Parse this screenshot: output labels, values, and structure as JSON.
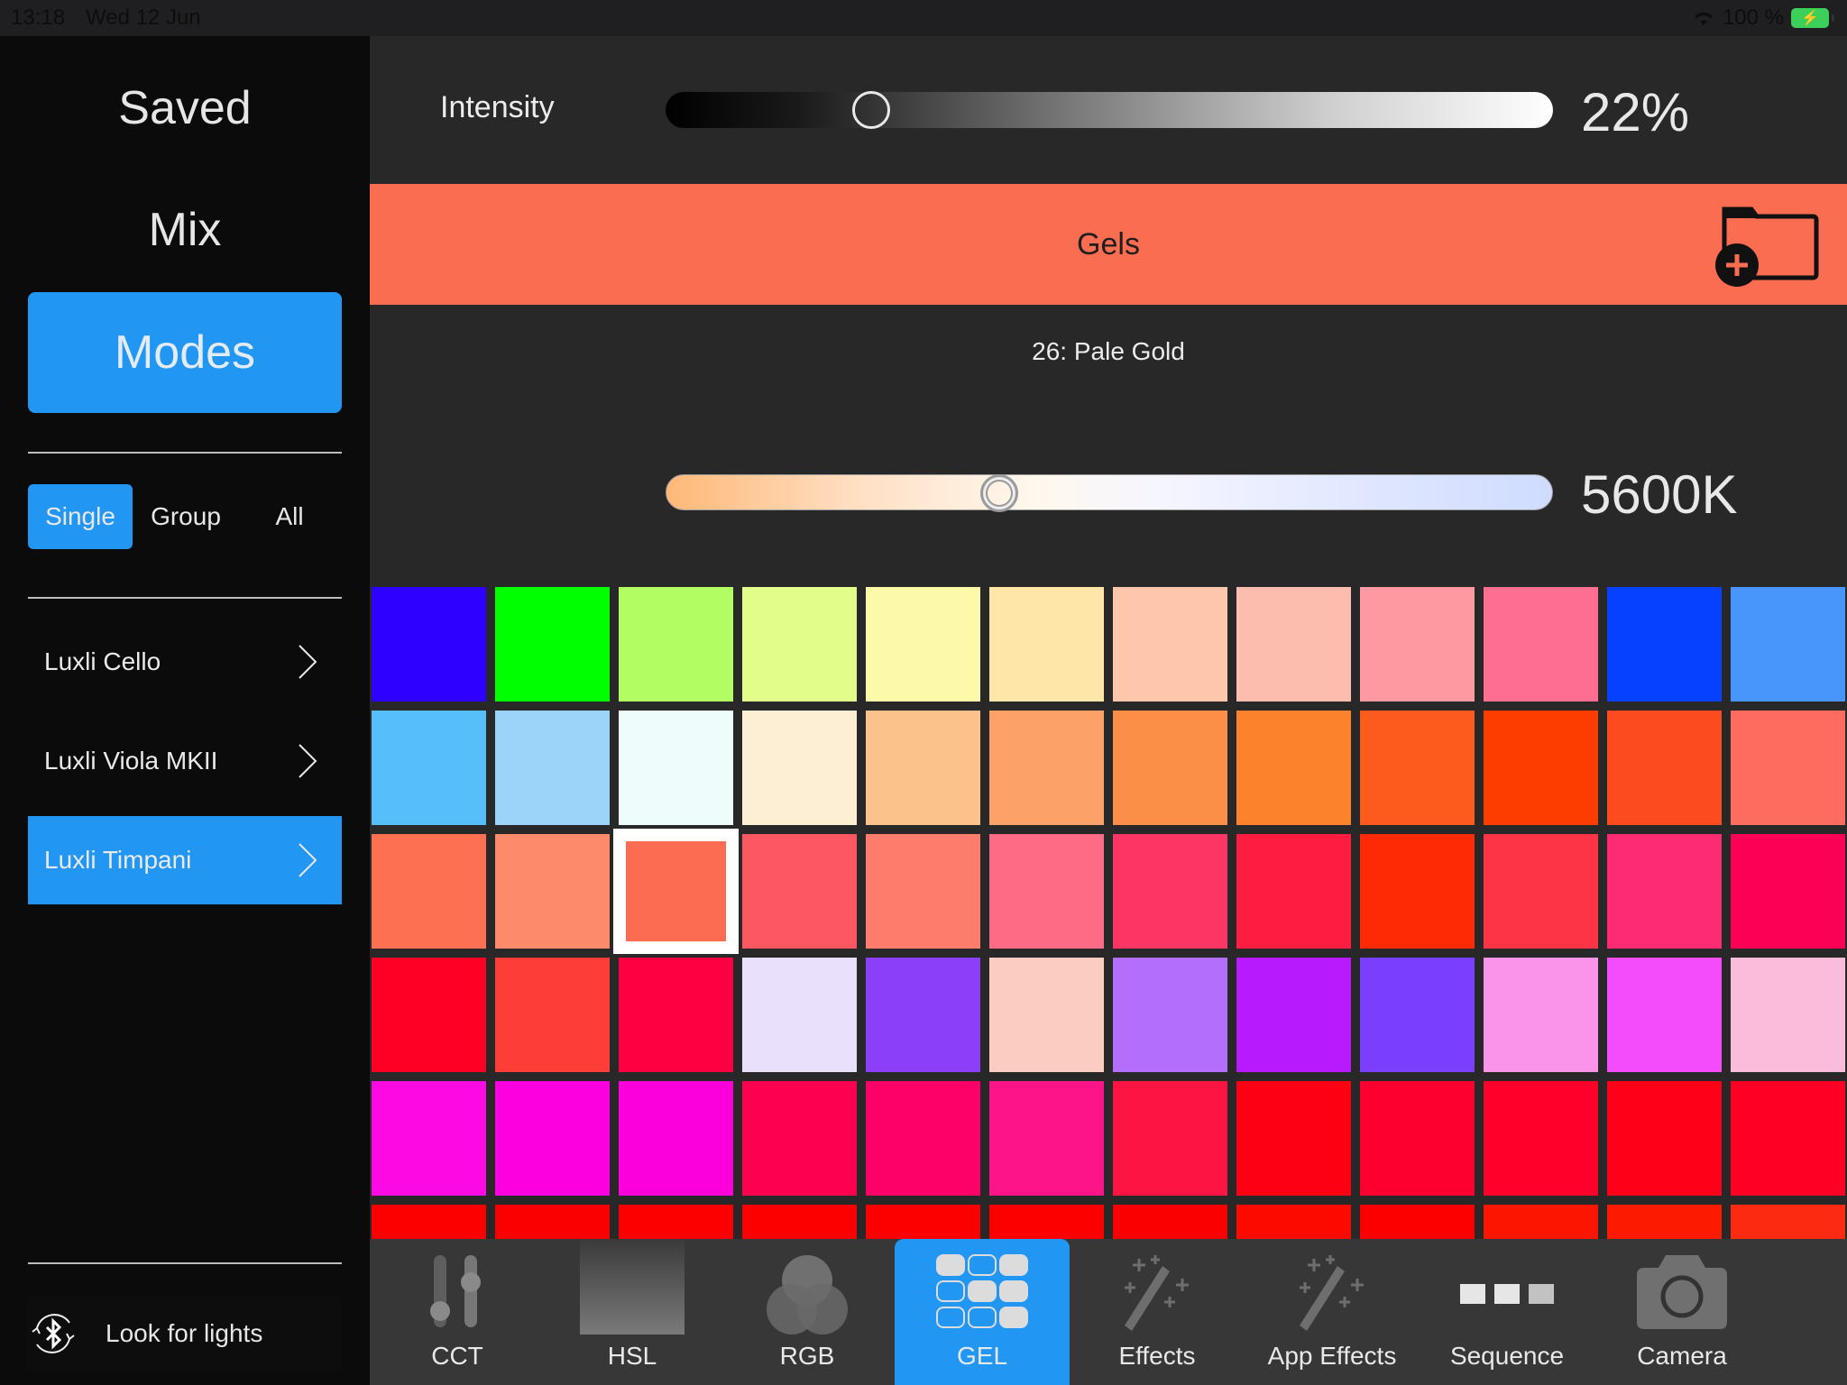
{
  "status_bar": {
    "time": "13:18",
    "date": "Wed 12 Jun",
    "battery": "100 %"
  },
  "sidebar": {
    "nav": [
      {
        "label": "Saved",
        "active": false
      },
      {
        "label": "Mix",
        "active": false
      },
      {
        "label": "Modes",
        "active": true
      }
    ],
    "scope": [
      {
        "label": "Single",
        "active": true
      },
      {
        "label": "Group",
        "active": false
      },
      {
        "label": "All",
        "active": false
      }
    ],
    "lights": [
      {
        "label": "Luxli Cello",
        "active": false
      },
      {
        "label": "Luxli Viola MKII",
        "active": false
      },
      {
        "label": "Luxli Timpani",
        "active": true
      }
    ],
    "look_for_lights": "Look for lights"
  },
  "intensity": {
    "label": "Intensity",
    "value_text": "22%",
    "value_fraction": 0.22
  },
  "gels_header": {
    "title": "Gels",
    "color": "#fa6d51"
  },
  "selected_gel": {
    "name": "26: Pale Gold"
  },
  "cct": {
    "value_text": "5600K",
    "value_fraction": 0.37
  },
  "accent_color": "#2196f3",
  "swatches": {
    "selected_index": 26,
    "rows": [
      [
        "#2d00ff",
        "#00ff00",
        "#b1fd62",
        "#e3fd8a",
        "#fcfaa8",
        "#fde6a8",
        "#fec7ac",
        "#fdbdae",
        "#fd99a1",
        "#fe6d92",
        "#0541fe",
        "#4895fc"
      ],
      [
        "#56befb",
        "#9bd4f9",
        "#eefcfb",
        "#fcefd4",
        "#fbc38b",
        "#fca167",
        "#fc8f48",
        "#fd822c",
        "#fb5c1e",
        "#fd3c00",
        "#fc4c1f",
        "#fd6c5e"
      ],
      [
        "#fd7051",
        "#fd8a6b",
        "#fb6c53",
        "#fd5861",
        "#fd7c6c",
        "#fd6b84",
        "#fd3565",
        "#fe1d41",
        "#fd2a05",
        "#fd3446",
        "#fd2b73",
        "#fc0056"
      ],
      [
        "#fe0026",
        "#fd3d38",
        "#fe0042",
        "#e9e1fb",
        "#8b3ff8",
        "#fbcdc2",
        "#b36ffa",
        "#b71afd",
        "#7a3ffc",
        "#fa94ea",
        "#f44bfb",
        "#fbbcdc"
      ],
      [
        "#fb0ae3",
        "#fc00e0",
        "#fb00da",
        "#fd0050",
        "#fd0068",
        "#fd1488",
        "#fd1442",
        "#fd0013",
        "#fd0030",
        "#fe002a",
        "#fe0017",
        "#fd0024"
      ],
      [
        "#fc0000",
        "#fb0000",
        "#fc0000",
        "#fc0000",
        "#fc0000",
        "#fc0000",
        "#fb0000",
        "#fc0a00",
        "#fc0000",
        "#fc1500",
        "#fc1a00",
        "#fc2a10"
      ]
    ]
  },
  "tabs": [
    {
      "label": "CCT",
      "icon": "cct-sliders-icon",
      "active": false
    },
    {
      "label": "HSL",
      "icon": "hsl-gradient-icon",
      "active": false
    },
    {
      "label": "RGB",
      "icon": "rgb-circles-icon",
      "active": false
    },
    {
      "label": "GEL",
      "icon": "gel-grid-icon",
      "active": true
    },
    {
      "label": "Effects",
      "icon": "magic-wand-icon",
      "active": false
    },
    {
      "label": "App Effects",
      "icon": "magic-wand-icon",
      "active": false
    },
    {
      "label": "Sequence",
      "icon": "sequence-icon",
      "active": false
    },
    {
      "label": "Camera",
      "icon": "camera-icon",
      "active": false
    }
  ]
}
